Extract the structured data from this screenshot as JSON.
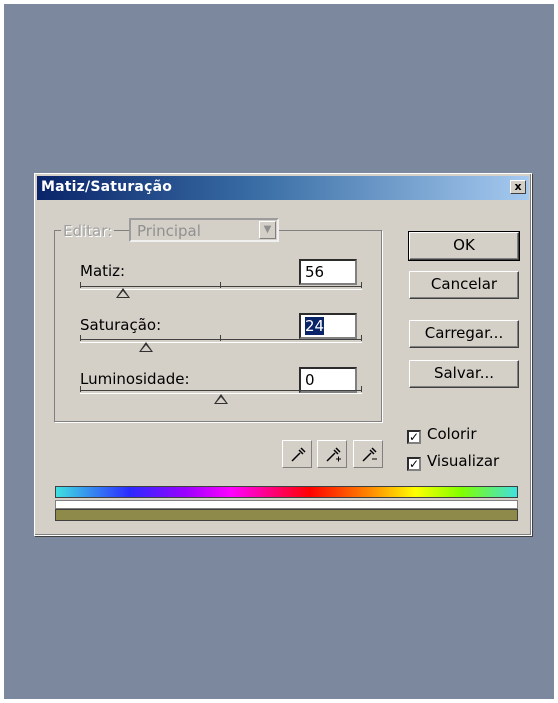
{
  "dialog": {
    "title": "Matiz/Saturação",
    "close_label": "x",
    "edit": {
      "label": "Editar:",
      "selected": "Principal"
    },
    "fields": [
      {
        "label": "Matiz:",
        "value": "56",
        "slider_fraction": 0.24
      },
      {
        "label": "Saturação:",
        "value": "24",
        "slider_fraction": 0.24
      },
      {
        "label": "Luminosidade:",
        "value": "0",
        "slider_fraction": 0.5
      }
    ],
    "buttons": {
      "ok": "OK",
      "cancel": "Cancelar",
      "load": "Carregar...",
      "save": "Salvar..."
    },
    "checkboxes": [
      {
        "label": "Colorir",
        "checked": true
      },
      {
        "label": "Visualizar",
        "checked": true
      }
    ],
    "colorize_color": "#8e8a4a"
  }
}
